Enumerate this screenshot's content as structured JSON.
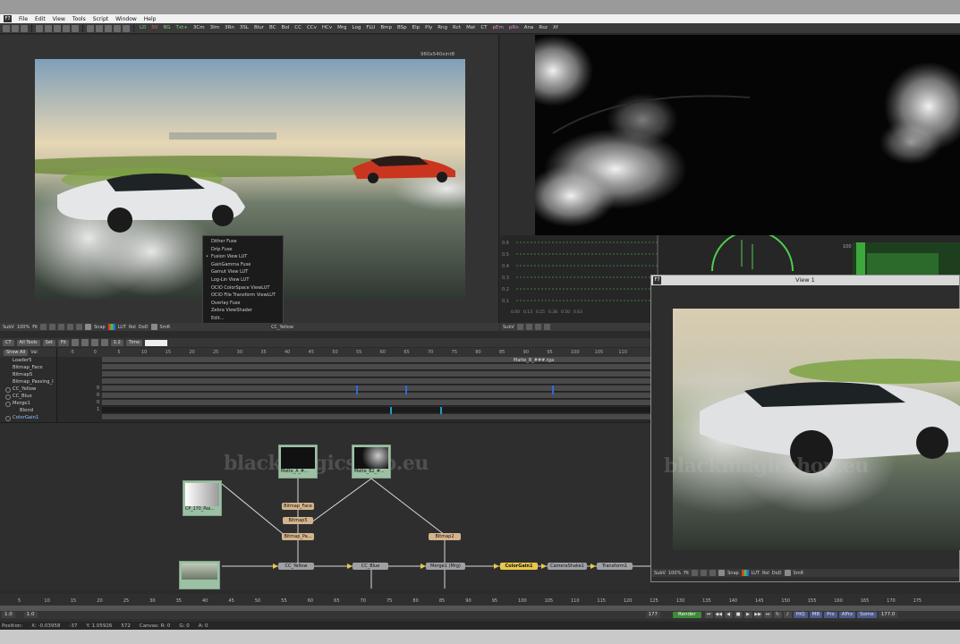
{
  "app": {
    "menu": [
      "File",
      "Edit",
      "View",
      "Tools",
      "Script",
      "Window",
      "Help"
    ]
  },
  "toolbar": {
    "tools": [
      {
        "label": "LD",
        "color": "green"
      },
      {
        "label": "SV",
        "color": "red"
      },
      {
        "label": "BG",
        "color": "green"
      },
      {
        "label": "Txt+",
        "color": "green"
      },
      {
        "label": "3Cm",
        "color": ""
      },
      {
        "label": "3Im",
        "color": ""
      },
      {
        "label": "3Rn",
        "color": ""
      },
      {
        "label": "3SL",
        "color": ""
      },
      {
        "label": "Blur",
        "color": ""
      },
      {
        "label": "BC",
        "color": ""
      },
      {
        "label": "Bol",
        "color": ""
      },
      {
        "label": "CC",
        "color": ""
      },
      {
        "label": "CCv",
        "color": ""
      },
      {
        "label": "HCv",
        "color": ""
      },
      {
        "label": "Mrg",
        "color": ""
      },
      {
        "label": "Log",
        "color": ""
      },
      {
        "label": "FLU",
        "color": ""
      },
      {
        "label": "Bmp",
        "color": ""
      },
      {
        "label": "BSp",
        "color": ""
      },
      {
        "label": "Elp",
        "color": ""
      },
      {
        "label": "Ply",
        "color": ""
      },
      {
        "label": "Rng",
        "color": ""
      },
      {
        "label": "Rct",
        "color": ""
      },
      {
        "label": "Mat",
        "color": ""
      },
      {
        "label": "CT",
        "color": ""
      },
      {
        "label": "pEm",
        "color": "pink"
      },
      {
        "label": "pRn",
        "color": "pink"
      },
      {
        "label": "Ana",
        "color": ""
      },
      {
        "label": "Rsz",
        "color": ""
      },
      {
        "label": "Xf",
        "color": ""
      }
    ]
  },
  "viewer_left": {
    "resolution": "960x540xint8",
    "bar": {
      "subview": "SubV",
      "zoom": "100%",
      "fit": "Fit",
      "snap": "Snap",
      "lut": "LUT",
      "roi": "RoI",
      "dod": "DoD",
      "smr": "SmR",
      "node": "CC_Yellow"
    },
    "context_menu": [
      {
        "label": "Dither Fuse",
        "checked": false
      },
      {
        "label": "Drip Fuse",
        "checked": false
      },
      {
        "label": "Fusion View LUT",
        "checked": true
      },
      {
        "label": "GainGamma Fuse",
        "checked": false
      },
      {
        "label": "Gamut View LUT",
        "checked": false
      },
      {
        "label": "Log-Lin View LUT",
        "checked": false
      },
      {
        "label": "OCIO ColorSpace ViewLUT",
        "checked": false
      },
      {
        "label": "OCIO File Transform ViewLUT",
        "checked": false
      },
      {
        "label": "Overlay Fuse",
        "checked": false
      },
      {
        "label": "Zebra ViewShader",
        "checked": false
      },
      {
        "label": "Edit...",
        "checked": false
      }
    ]
  },
  "viewer_right": {
    "bar": {
      "subview": "SubV"
    },
    "scope_labels": [
      "0.6",
      "0.5",
      "0.4",
      "0.3",
      "0.2",
      "0.1"
    ],
    "scope_x_labels": [
      "0.00",
      "0.13",
      "0.25",
      "0.38",
      "0.50",
      "0.63"
    ],
    "histogram_top": "100"
  },
  "timeline": {
    "toolbar": {
      "ct": "CT",
      "all_tools": "All Tools",
      "set": "Set",
      "fit": "Fit",
      "time": "Time",
      "ratio": "1:2"
    },
    "list_header": {
      "show_all": "Show All",
      "val": "Val"
    },
    "items": [
      {
        "label": "Loader5",
        "dot": false,
        "sel": false,
        "indent": false
      },
      {
        "label": "Bitmap_Face",
        "dot": false,
        "sel": false,
        "indent": false
      },
      {
        "label": "Bitmap5",
        "dot": false,
        "sel": false,
        "indent": false
      },
      {
        "label": "Bitmap_Passing_I",
        "dot": false,
        "sel": false,
        "indent": false
      },
      {
        "label": "CC_Yellow",
        "dot": true,
        "sel": false,
        "indent": false
      },
      {
        "label": "CC_Blue",
        "dot": true,
        "sel": false,
        "indent": false
      },
      {
        "label": "Merge1",
        "dot": true,
        "sel": false,
        "indent": false
      },
      {
        "label": "Blend",
        "dot": false,
        "sel": false,
        "indent": true
      },
      {
        "label": "ColorGain1",
        "dot": true,
        "sel": true,
        "indent": false
      }
    ],
    "ruler": [
      "-5",
      "0",
      "5",
      "10",
      "15",
      "20",
      "25",
      "30",
      "35",
      "40",
      "45",
      "50",
      "55",
      "60",
      "65",
      "70",
      "75",
      "80",
      "85",
      "90",
      "95",
      "100",
      "105",
      "110"
    ],
    "clip_label": "Matte_B_###.tga",
    "row_values": [
      "0",
      "0",
      "0",
      "1"
    ]
  },
  "flow": {
    "watermark": "blackmagicshop.eu",
    "nodes": {
      "matte_a": "Matte_A_#...",
      "matte_b": "Matte_B2_#...",
      "cp": "CP_170_Pas...",
      "bitmap_face": "Bitmap_Face",
      "bitmap5": "Bitmap5",
      "bitmap_pa": "Bitmap_Pa...",
      "bitmap2": "Bitmap2",
      "cc_yellow": "CC_Yellow",
      "cc_blue": "CC_Blue",
      "merge1": "Merge1 (Mrg)",
      "colorgain1": "ColorGain1",
      "camerashake1": "CameraShake1",
      "transform1": "Transform1"
    }
  },
  "float_viewer": {
    "title": "View 1",
    "watermark": "blackmagicshop.eu",
    "bar": {
      "subview": "SubV",
      "zoom": "100%",
      "fit": "Fit",
      "snap": "Snap",
      "lut": "LUT",
      "roi": "RoI",
      "dod": "DoD",
      "smr": "SmR"
    }
  },
  "transport": {
    "ticks": [
      "5",
      "10",
      "15",
      "20",
      "25",
      "30",
      "35",
      "40",
      "45",
      "50",
      "55",
      "60",
      "65",
      "70",
      "75",
      "80",
      "85",
      "90",
      "95",
      "100",
      "105",
      "110",
      "115",
      "120",
      "125",
      "130",
      "135",
      "140",
      "145",
      "150",
      "155",
      "160",
      "165",
      "170",
      "175"
    ],
    "start": "1.0",
    "render_start": "1.0",
    "current": "177",
    "render_label": "Render",
    "modes": [
      "HiQ",
      "MB",
      "Prx",
      "APrx",
      "Some"
    ],
    "end": "177.0"
  },
  "status": {
    "position": "Position:",
    "x": "X: -0.03958",
    "xpix": "-37",
    "y": "Y: 1.05926",
    "ypix": "572",
    "canvas": "Canvas:  R: 0",
    "g": "G: 0",
    "a": "A: 0"
  }
}
